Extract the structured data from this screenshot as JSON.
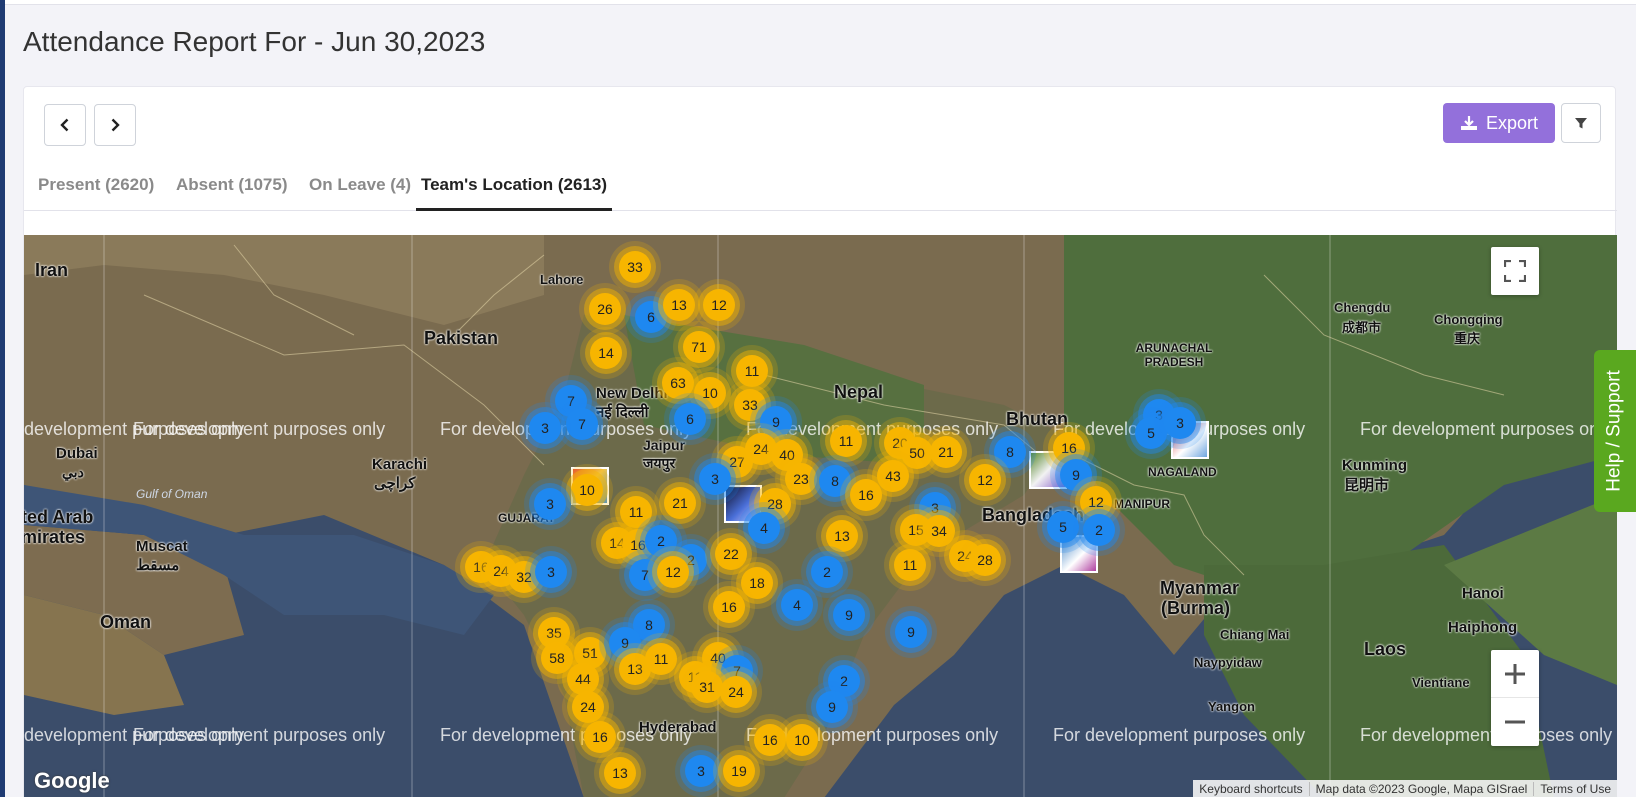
{
  "page": {
    "title": "Attendance Report For - Jun 30,2023"
  },
  "toolbar": {
    "export_label": "Export"
  },
  "tabs": [
    {
      "label": "Present (2620)"
    },
    {
      "label": "Absent (1075)"
    },
    {
      "label": "On Leave (4)"
    },
    {
      "label": "Team's Location (2613)"
    }
  ],
  "map": {
    "watermark": "For development purposes only",
    "places": [
      {
        "label": "Iran"
      },
      {
        "label": "Lahore"
      },
      {
        "label": "Pakistan"
      },
      {
        "label": "Nepal"
      },
      {
        "label": "Bhutan"
      },
      {
        "label": "Chengdu"
      },
      {
        "label": "成都市"
      },
      {
        "label": "Chongqing"
      },
      {
        "label": "重庆"
      },
      {
        "label": "ARUNACHAL PRADESH"
      },
      {
        "label": "New Delhi"
      },
      {
        "label": "नई दिल्ली"
      },
      {
        "label": "Jaipur"
      },
      {
        "label": "जयपुर"
      },
      {
        "label": "Karachi"
      },
      {
        "label": "کراچی"
      },
      {
        "label": "Dubai"
      },
      {
        "label": "دبي"
      },
      {
        "label": "Gulf of Oman"
      },
      {
        "label": "ted Arab"
      },
      {
        "label": "mirates"
      },
      {
        "label": "Muscat"
      },
      {
        "label": "مسقط"
      },
      {
        "label": "Oman"
      },
      {
        "label": "Bangladesh"
      },
      {
        "label": "Kunming"
      },
      {
        "label": "昆明市"
      },
      {
        "label": "Myanmar"
      },
      {
        "label": "(Burma)"
      },
      {
        "label": "Hanoi"
      },
      {
        "label": "Chiang Mai"
      },
      {
        "label": "Haiphong"
      },
      {
        "label": "Laos"
      },
      {
        "label": "Naypyidaw"
      },
      {
        "label": "Vientiane"
      },
      {
        "label": "Yangon"
      },
      {
        "label": "Hyderabad"
      },
      {
        "label": "GUJARAT"
      },
      {
        "label": "NAGALAND"
      },
      {
        "label": "MANIPUR"
      }
    ],
    "clusters": [
      {
        "count": "33",
        "color": "y"
      },
      {
        "count": "26",
        "color": "y"
      },
      {
        "count": "6",
        "color": "b"
      },
      {
        "count": "13",
        "color": "y"
      },
      {
        "count": "12",
        "color": "y"
      },
      {
        "count": "71",
        "color": "y"
      },
      {
        "count": "14",
        "color": "y"
      },
      {
        "count": "11",
        "color": "y"
      },
      {
        "count": "63",
        "color": "y"
      },
      {
        "count": "10",
        "color": "y"
      },
      {
        "count": "33",
        "color": "y"
      },
      {
        "count": "7",
        "color": "b"
      },
      {
        "count": "7",
        "color": "b"
      },
      {
        "count": "3",
        "color": "b"
      },
      {
        "count": "6",
        "color": "b"
      },
      {
        "count": "9",
        "color": "b"
      },
      {
        "count": "11",
        "color": "y"
      },
      {
        "count": "27",
        "color": "y"
      },
      {
        "count": "24",
        "color": "y"
      },
      {
        "count": "40",
        "color": "y"
      },
      {
        "count": "23",
        "color": "y"
      },
      {
        "count": "8",
        "color": "b"
      },
      {
        "count": "3",
        "color": "b"
      },
      {
        "count": "10",
        "color": "y"
      },
      {
        "count": "3",
        "color": "b"
      },
      {
        "count": "11",
        "color": "y"
      },
      {
        "count": "21",
        "color": "y"
      },
      {
        "count": "28",
        "color": "y"
      },
      {
        "count": "4",
        "color": "b"
      },
      {
        "count": "14",
        "color": "y"
      },
      {
        "count": "16",
        "color": "y"
      },
      {
        "count": "2",
        "color": "b"
      },
      {
        "count": "2",
        "color": "b"
      },
      {
        "count": "22",
        "color": "y"
      },
      {
        "count": "16",
        "color": "y"
      },
      {
        "count": "24",
        "color": "y"
      },
      {
        "count": "32",
        "color": "y"
      },
      {
        "count": "3",
        "color": "b"
      },
      {
        "count": "7",
        "color": "b"
      },
      {
        "count": "12",
        "color": "y"
      },
      {
        "count": "18",
        "color": "y"
      },
      {
        "count": "13",
        "color": "y"
      },
      {
        "count": "2",
        "color": "b"
      },
      {
        "count": "16",
        "color": "y"
      },
      {
        "count": "4",
        "color": "b"
      },
      {
        "count": "9",
        "color": "b"
      },
      {
        "count": "20",
        "color": "y"
      },
      {
        "count": "50",
        "color": "y"
      },
      {
        "count": "21",
        "color": "y"
      },
      {
        "count": "43",
        "color": "y"
      },
      {
        "count": "16",
        "color": "y"
      },
      {
        "count": "3",
        "color": "b"
      },
      {
        "count": "15",
        "color": "y"
      },
      {
        "count": "34",
        "color": "y"
      },
      {
        "count": "11",
        "color": "y"
      },
      {
        "count": "24",
        "color": "y"
      },
      {
        "count": "28",
        "color": "y"
      },
      {
        "count": "9",
        "color": "b"
      },
      {
        "count": "8",
        "color": "b"
      },
      {
        "count": "12",
        "color": "y"
      },
      {
        "count": "16",
        "color": "y"
      },
      {
        "count": "9",
        "color": "b"
      },
      {
        "count": "12",
        "color": "y"
      },
      {
        "count": "5",
        "color": "b"
      },
      {
        "count": "2",
        "color": "b"
      },
      {
        "count": "3",
        "color": "b"
      },
      {
        "count": "5",
        "color": "b"
      },
      {
        "count": "3",
        "color": "b"
      },
      {
        "count": "35",
        "color": "y"
      },
      {
        "count": "58",
        "color": "y"
      },
      {
        "count": "51",
        "color": "y"
      },
      {
        "count": "8",
        "color": "b"
      },
      {
        "count": "9",
        "color": "b"
      },
      {
        "count": "13",
        "color": "y"
      },
      {
        "count": "11",
        "color": "y"
      },
      {
        "count": "40",
        "color": "y"
      },
      {
        "count": "7",
        "color": "b"
      },
      {
        "count": "44",
        "color": "y"
      },
      {
        "count": "11",
        "color": "y"
      },
      {
        "count": "31",
        "color": "y"
      },
      {
        "count": "24",
        "color": "y"
      },
      {
        "count": "2",
        "color": "b"
      },
      {
        "count": "9",
        "color": "b"
      },
      {
        "count": "24",
        "color": "y"
      },
      {
        "count": "16",
        "color": "y"
      },
      {
        "count": "16",
        "color": "y"
      },
      {
        "count": "10",
        "color": "y"
      },
      {
        "count": "13",
        "color": "y"
      },
      {
        "count": "3",
        "color": "b"
      },
      {
        "count": "19",
        "color": "y"
      }
    ],
    "keyboard_shortcuts": "Keyboard shortcuts",
    "map_data": "Map data ©2023 Google, Mapa GISrael",
    "terms": "Terms of Use",
    "logo_text": "Google"
  },
  "help": {
    "label": "Help / Support"
  },
  "colors": {
    "export": "#9370db",
    "help": "#5aa81f",
    "cluster_yellow": "#f7b500",
    "cluster_blue": "#1e88f0"
  }
}
